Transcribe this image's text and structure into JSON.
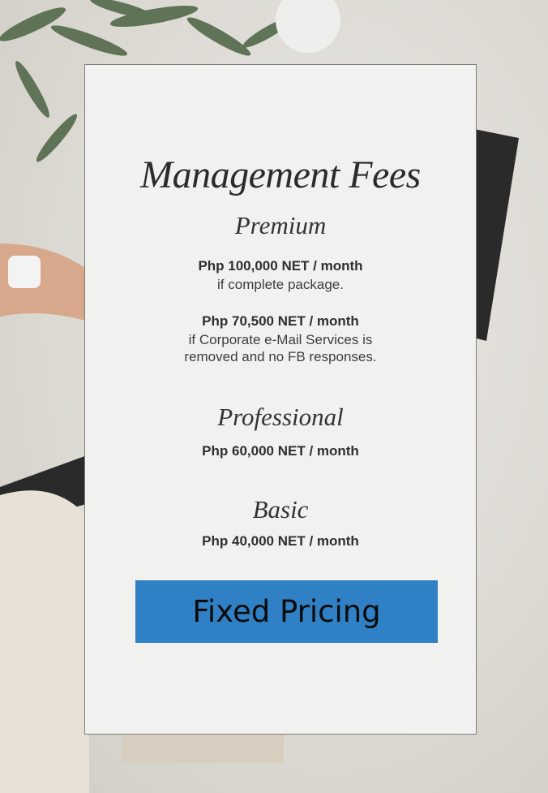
{
  "card": {
    "title": "Management Fees",
    "tiers": [
      {
        "name": "Premium",
        "options": [
          {
            "price": "Php 100,000 NET / month",
            "note": "if complete package."
          },
          {
            "price": "Php 70,500 NET / month",
            "note_lines": [
              "if Corporate e-Mail Services is",
              "removed and no FB responses."
            ]
          }
        ]
      },
      {
        "name": "Professional",
        "price": "Php 60,000 NET / month"
      },
      {
        "name": "Basic",
        "price": "Php 40,000 NET / month"
      }
    ],
    "badge_label": "Fixed Pricing"
  },
  "colors": {
    "badge": "#2f80c4",
    "card": "#f1f1f0"
  }
}
